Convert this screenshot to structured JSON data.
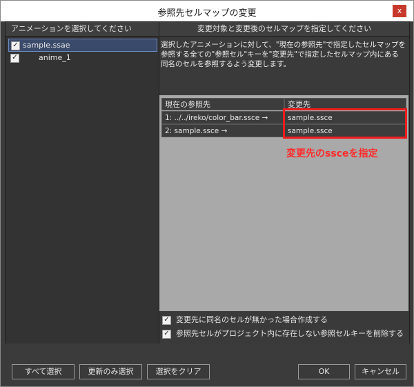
{
  "window": {
    "title": "参照先セルマップの変更",
    "close_label": "x"
  },
  "left_pane": {
    "header": "アニメーションを選択してください",
    "tree": [
      {
        "label": "sample.ssae",
        "checked": true,
        "selected": true
      },
      {
        "label": "anime_1",
        "checked": true,
        "selected": false
      }
    ]
  },
  "right_pane": {
    "header": "変更対象と変更後のセルマップを指定してください",
    "description": "選択したアニメーションに対して、\"現在の参照先\"で指定したセルマップを参照する全ての\"参照セル\"キーを\"変更先\"で指定したセルマップ内にある同名のセルを参照するよう変更します。",
    "columns": [
      "現在の参照先",
      "変更先"
    ],
    "rows": [
      {
        "current": "1: ../../ireko/color_bar.ssce →",
        "target": "sample.ssce"
      },
      {
        "current": "2: sample.ssce →",
        "target": "sample.ssce"
      }
    ],
    "annotation": "変更先のssceを指定",
    "highlight_color": "#ee1c1c",
    "options": [
      {
        "label": "変更先に同名のセルが無かった場合作成する",
        "checked": true
      },
      {
        "label": "参照先セルがプロジェクト内に存在しない参照セルキーを削除する",
        "checked": true
      }
    ]
  },
  "buttons": {
    "select_all": "すべて選択",
    "select_updated": "更新のみ選択",
    "clear_selection": "選択をクリア",
    "ok": "OK",
    "cancel": "キャンセル"
  }
}
